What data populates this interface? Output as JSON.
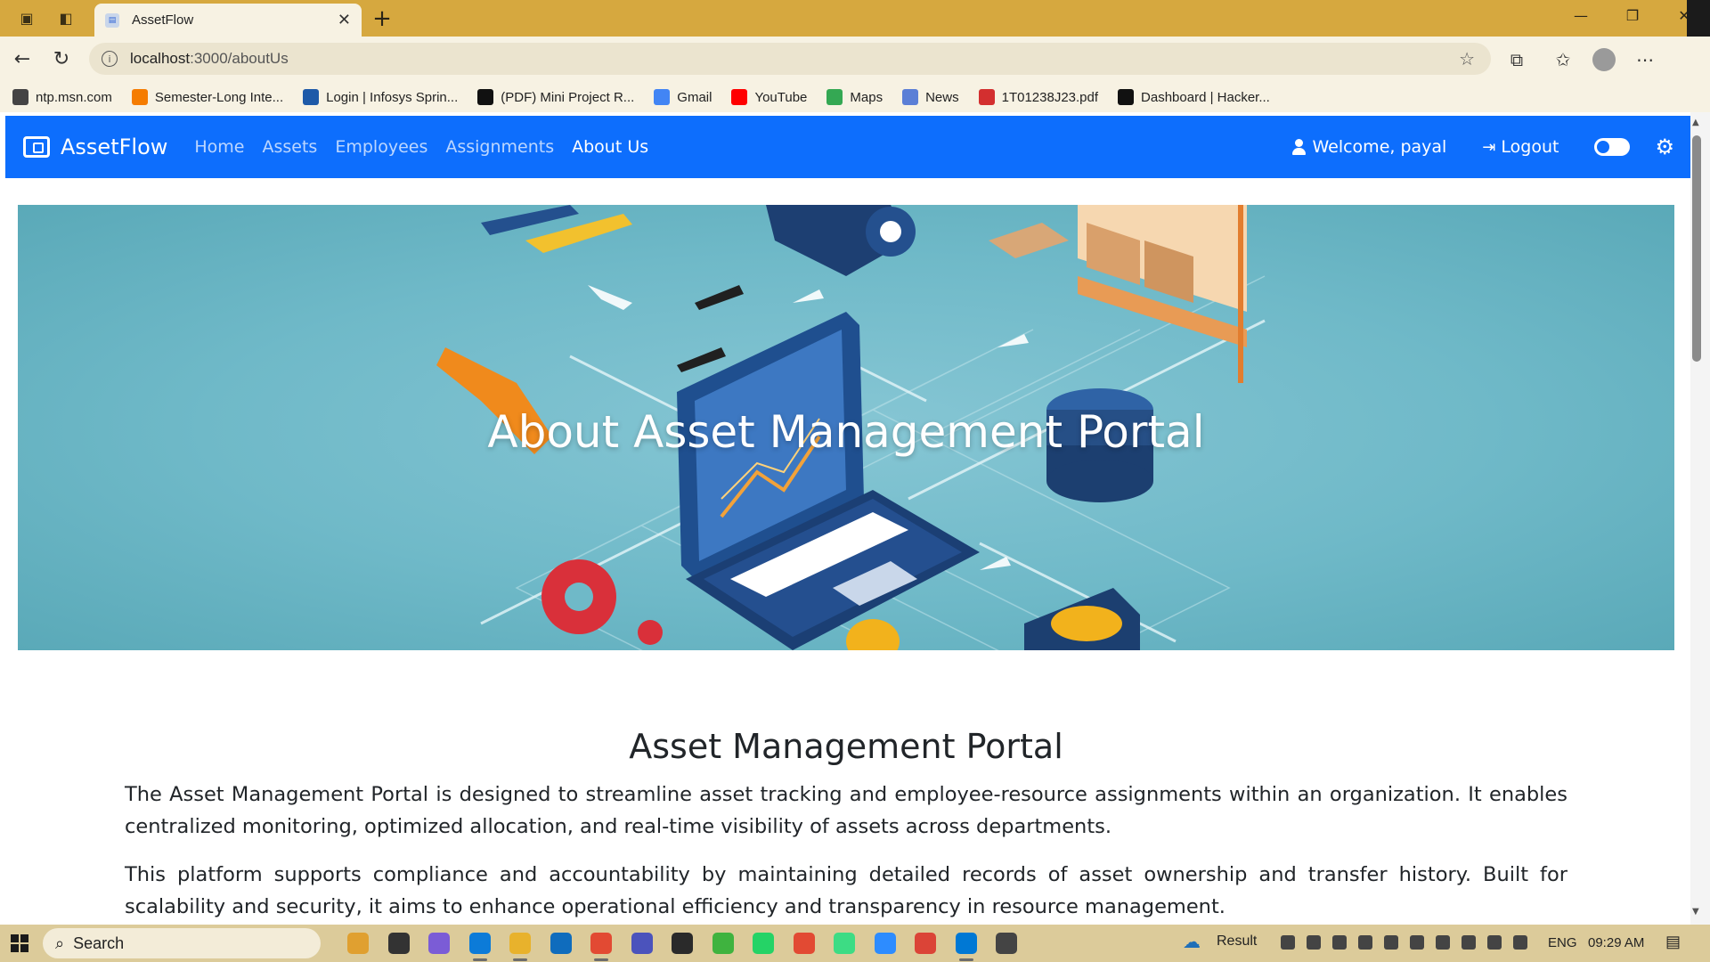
{
  "browser": {
    "tab_title": "AssetFlow",
    "url_host": "localhost",
    "url_rest": ":3000/aboutUs",
    "bookmarks": [
      {
        "label": "ntp.msn.com",
        "icon": "globe-icon",
        "color": "#444444"
      },
      {
        "label": "Semester-Long Inte...",
        "icon": "semester-icon",
        "color": "#f57c00"
      },
      {
        "label": "Login | Infosys Sprin...",
        "icon": "infosys-icon",
        "color": "#1e5aa8"
      },
      {
        "label": "(PDF) Mini Project R...",
        "icon": "academia-icon",
        "color": "#111111"
      },
      {
        "label": "Gmail",
        "icon": "google-icon",
        "color": "#4285f4"
      },
      {
        "label": "YouTube",
        "icon": "youtube-icon",
        "color": "#ff0000"
      },
      {
        "label": "Maps",
        "icon": "maps-icon",
        "color": "#34a853"
      },
      {
        "label": "News",
        "icon": "news-icon",
        "color": "#5b7fd6"
      },
      {
        "label": "1T01238J23.pdf",
        "icon": "pdf-icon",
        "color": "#d32f2f"
      },
      {
        "label": "Dashboard | Hacker...",
        "icon": "hackerrank-icon",
        "color": "#111111"
      }
    ],
    "colors": {
      "titlebar": "#d6a83f",
      "toolbar": "#f7f2e3"
    }
  },
  "navbar": {
    "brand": "AssetFlow",
    "links": [
      "Home",
      "Assets",
      "Employees",
      "Assignments",
      "About Us"
    ],
    "active_link": "About Us",
    "welcome": "Welcome, payal",
    "logout": "Logout",
    "color": "#0d6efd"
  },
  "hero": {
    "title": "About Asset Management Portal"
  },
  "content": {
    "heading": "Asset Management Portal",
    "paragraphs": [
      "The Asset Management Portal is designed to streamline asset tracking and employee-resource assignments within an organization. It enables centralized monitoring, optimized allocation, and real-time visibility of assets across departments.",
      "This platform supports compliance and accountability by maintaining detailed records of asset ownership and transfer history. Built for scalability and security, it aims to enhance operational efficiency and transparency in resource management."
    ]
  },
  "taskbar": {
    "search_placeholder": "Search",
    "weather_label": "Result",
    "language": "ENG",
    "time": "09:29 AM",
    "apps": [
      "widgets-icon",
      "task-view-icon",
      "copilot-icon",
      "edge-icon",
      "file-explorer-icon",
      "outlook-icon",
      "chrome-icon",
      "teams-icon",
      "wordpress-icon",
      "chat-icon",
      "whatsapp-icon",
      "chrome-profile-icon",
      "android-studio-icon",
      "zoom-icon",
      "chrome-alt-icon",
      "vscode-icon",
      "snipping-tool-icon"
    ]
  }
}
